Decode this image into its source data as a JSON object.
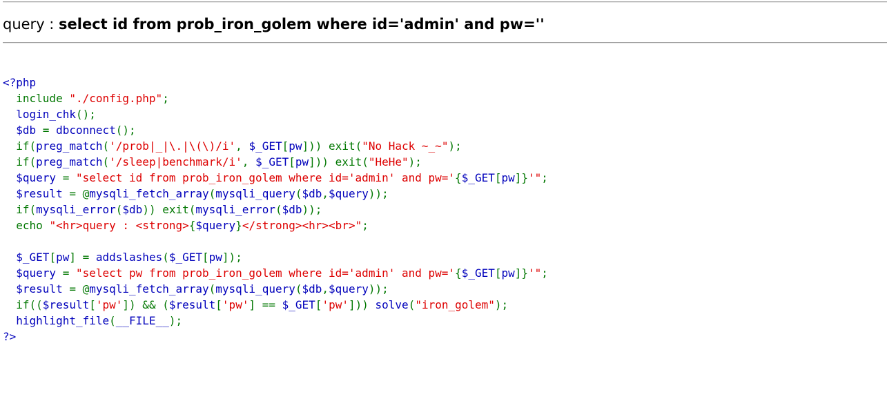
{
  "query_header": {
    "prefix": "query : ",
    "sql": "select id from prob_iron_golem where id='admin' and pw=''"
  },
  "colors": {
    "default": "#0000BB",
    "keyword": "#007700",
    "string": "#DD0000"
  },
  "source_code": [
    [
      {
        "t": "default",
        "v": "<?php"
      }
    ],
    [
      {
        "t": "default",
        "v": "  "
      },
      {
        "t": "keyword",
        "v": "include "
      },
      {
        "t": "string",
        "v": "\"./config.php\""
      },
      {
        "t": "keyword",
        "v": ";"
      }
    ],
    [
      {
        "t": "default",
        "v": "  login_chk"
      },
      {
        "t": "keyword",
        "v": "();"
      }
    ],
    [
      {
        "t": "default",
        "v": "  $db "
      },
      {
        "t": "keyword",
        "v": "= "
      },
      {
        "t": "default",
        "v": "dbconnect"
      },
      {
        "t": "keyword",
        "v": "();"
      }
    ],
    [
      {
        "t": "default",
        "v": "  "
      },
      {
        "t": "keyword",
        "v": "if("
      },
      {
        "t": "default",
        "v": "preg_match"
      },
      {
        "t": "keyword",
        "v": "("
      },
      {
        "t": "string",
        "v": "'/prob|_|\\.|\\(\\)/i'"
      },
      {
        "t": "keyword",
        "v": ", "
      },
      {
        "t": "default",
        "v": "$_GET"
      },
      {
        "t": "keyword",
        "v": "["
      },
      {
        "t": "default",
        "v": "pw"
      },
      {
        "t": "keyword",
        "v": "])) exit("
      },
      {
        "t": "string",
        "v": "\"No Hack ~_~\""
      },
      {
        "t": "keyword",
        "v": ");"
      }
    ],
    [
      {
        "t": "default",
        "v": "  "
      },
      {
        "t": "keyword",
        "v": "if("
      },
      {
        "t": "default",
        "v": "preg_match"
      },
      {
        "t": "keyword",
        "v": "("
      },
      {
        "t": "string",
        "v": "'/sleep|benchmark/i'"
      },
      {
        "t": "keyword",
        "v": ", "
      },
      {
        "t": "default",
        "v": "$_GET"
      },
      {
        "t": "keyword",
        "v": "["
      },
      {
        "t": "default",
        "v": "pw"
      },
      {
        "t": "keyword",
        "v": "])) exit("
      },
      {
        "t": "string",
        "v": "\"HeHe\""
      },
      {
        "t": "keyword",
        "v": ");"
      }
    ],
    [
      {
        "t": "default",
        "v": "  $query "
      },
      {
        "t": "keyword",
        "v": "= "
      },
      {
        "t": "string",
        "v": "\"select id from prob_iron_golem where id='admin' and pw='"
      },
      {
        "t": "keyword",
        "v": "{"
      },
      {
        "t": "default",
        "v": "$_GET"
      },
      {
        "t": "keyword",
        "v": "["
      },
      {
        "t": "default",
        "v": "pw"
      },
      {
        "t": "keyword",
        "v": "]}"
      },
      {
        "t": "string",
        "v": "'\""
      },
      {
        "t": "keyword",
        "v": ";"
      }
    ],
    [
      {
        "t": "default",
        "v": "  $result "
      },
      {
        "t": "keyword",
        "v": "= @"
      },
      {
        "t": "default",
        "v": "mysqli_fetch_array"
      },
      {
        "t": "keyword",
        "v": "("
      },
      {
        "t": "default",
        "v": "mysqli_query"
      },
      {
        "t": "keyword",
        "v": "("
      },
      {
        "t": "default",
        "v": "$db"
      },
      {
        "t": "keyword",
        "v": ","
      },
      {
        "t": "default",
        "v": "$query"
      },
      {
        "t": "keyword",
        "v": "));"
      }
    ],
    [
      {
        "t": "default",
        "v": "  "
      },
      {
        "t": "keyword",
        "v": "if("
      },
      {
        "t": "default",
        "v": "mysqli_error"
      },
      {
        "t": "keyword",
        "v": "("
      },
      {
        "t": "default",
        "v": "$db"
      },
      {
        "t": "keyword",
        "v": ")) exit("
      },
      {
        "t": "default",
        "v": "mysqli_error"
      },
      {
        "t": "keyword",
        "v": "("
      },
      {
        "t": "default",
        "v": "$db"
      },
      {
        "t": "keyword",
        "v": "));"
      }
    ],
    [
      {
        "t": "default",
        "v": "  "
      },
      {
        "t": "keyword",
        "v": "echo "
      },
      {
        "t": "string",
        "v": "\"<hr>query : <strong>"
      },
      {
        "t": "keyword",
        "v": "{"
      },
      {
        "t": "default",
        "v": "$query"
      },
      {
        "t": "keyword",
        "v": "}"
      },
      {
        "t": "string",
        "v": "</strong><hr><br>\""
      },
      {
        "t": "keyword",
        "v": ";"
      }
    ],
    [
      {
        "t": "default",
        "v": ""
      }
    ],
    [
      {
        "t": "default",
        "v": "  $_GET"
      },
      {
        "t": "keyword",
        "v": "["
      },
      {
        "t": "default",
        "v": "pw"
      },
      {
        "t": "keyword",
        "v": "] = "
      },
      {
        "t": "default",
        "v": "addslashes"
      },
      {
        "t": "keyword",
        "v": "("
      },
      {
        "t": "default",
        "v": "$_GET"
      },
      {
        "t": "keyword",
        "v": "["
      },
      {
        "t": "default",
        "v": "pw"
      },
      {
        "t": "keyword",
        "v": "]);"
      }
    ],
    [
      {
        "t": "default",
        "v": "  $query "
      },
      {
        "t": "keyword",
        "v": "= "
      },
      {
        "t": "string",
        "v": "\"select pw from prob_iron_golem where id='admin' and pw='"
      },
      {
        "t": "keyword",
        "v": "{"
      },
      {
        "t": "default",
        "v": "$_GET"
      },
      {
        "t": "keyword",
        "v": "["
      },
      {
        "t": "default",
        "v": "pw"
      },
      {
        "t": "keyword",
        "v": "]}"
      },
      {
        "t": "string",
        "v": "'\""
      },
      {
        "t": "keyword",
        "v": ";"
      }
    ],
    [
      {
        "t": "default",
        "v": "  $result "
      },
      {
        "t": "keyword",
        "v": "= @"
      },
      {
        "t": "default",
        "v": "mysqli_fetch_array"
      },
      {
        "t": "keyword",
        "v": "("
      },
      {
        "t": "default",
        "v": "mysqli_query"
      },
      {
        "t": "keyword",
        "v": "("
      },
      {
        "t": "default",
        "v": "$db"
      },
      {
        "t": "keyword",
        "v": ","
      },
      {
        "t": "default",
        "v": "$query"
      },
      {
        "t": "keyword",
        "v": "));"
      }
    ],
    [
      {
        "t": "default",
        "v": "  "
      },
      {
        "t": "keyword",
        "v": "if(("
      },
      {
        "t": "default",
        "v": "$result"
      },
      {
        "t": "keyword",
        "v": "["
      },
      {
        "t": "string",
        "v": "'pw'"
      },
      {
        "t": "keyword",
        "v": "]) && ("
      },
      {
        "t": "default",
        "v": "$result"
      },
      {
        "t": "keyword",
        "v": "["
      },
      {
        "t": "string",
        "v": "'pw'"
      },
      {
        "t": "keyword",
        "v": "] == "
      },
      {
        "t": "default",
        "v": "$_GET"
      },
      {
        "t": "keyword",
        "v": "["
      },
      {
        "t": "string",
        "v": "'pw'"
      },
      {
        "t": "keyword",
        "v": "])) "
      },
      {
        "t": "default",
        "v": "solve"
      },
      {
        "t": "keyword",
        "v": "("
      },
      {
        "t": "string",
        "v": "\"iron_golem\""
      },
      {
        "t": "keyword",
        "v": ");"
      }
    ],
    [
      {
        "t": "default",
        "v": "  highlight_file"
      },
      {
        "t": "keyword",
        "v": "("
      },
      {
        "t": "default",
        "v": "__FILE__"
      },
      {
        "t": "keyword",
        "v": ");"
      }
    ],
    [
      {
        "t": "default",
        "v": "?>"
      }
    ]
  ]
}
